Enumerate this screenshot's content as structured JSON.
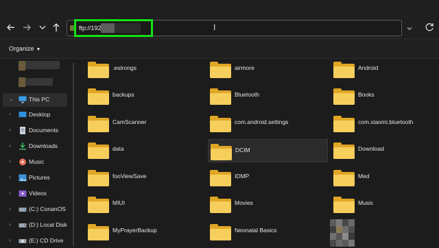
{
  "toolbar": {
    "back_icon": "arrow-left-icon",
    "forward_icon": "arrow-right-icon",
    "recent_icon": "chevron-down-icon",
    "up_icon": "arrow-up-icon",
    "address": "ftp://192",
    "refresh_icon": "refresh-icon"
  },
  "command_bar": {
    "organize_label": "Organize"
  },
  "sidebar": {
    "this_pc": "This PC",
    "items": [
      {
        "label": "Desktop",
        "icon": "desktop-icon"
      },
      {
        "label": "Documents",
        "icon": "documents-icon"
      },
      {
        "label": "Downloads",
        "icon": "downloads-icon"
      },
      {
        "label": "Music",
        "icon": "music-icon"
      },
      {
        "label": "Pictures",
        "icon": "pictures-icon"
      },
      {
        "label": "Videos",
        "icon": "videos-icon"
      },
      {
        "label": "(C:) ConanOS",
        "icon": "drive-icon"
      },
      {
        "label": "(D:) Local Disk",
        "icon": "drive-icon"
      },
      {
        "label": "(E:) CD Drive",
        "icon": "drive-icon"
      }
    ]
  },
  "folders": [
    ".estrongs",
    "airmore",
    "Android",
    "backups",
    "Bluetooth",
    "Books",
    "CamScanner",
    "com.android.settings",
    "com.xiaomi.bluetooth",
    "data",
    "DCIM",
    "Download",
    "fooViewSave",
    "IDMP",
    "Med",
    "MIUI",
    "Movies",
    "Music",
    "MyPrayerBackup",
    "Neonatal Basics"
  ],
  "selected_folder": "DCIM",
  "colors": {
    "highlight": "#15e015",
    "folder_front": "#f6ce5c",
    "folder_back": "#e0a625"
  }
}
